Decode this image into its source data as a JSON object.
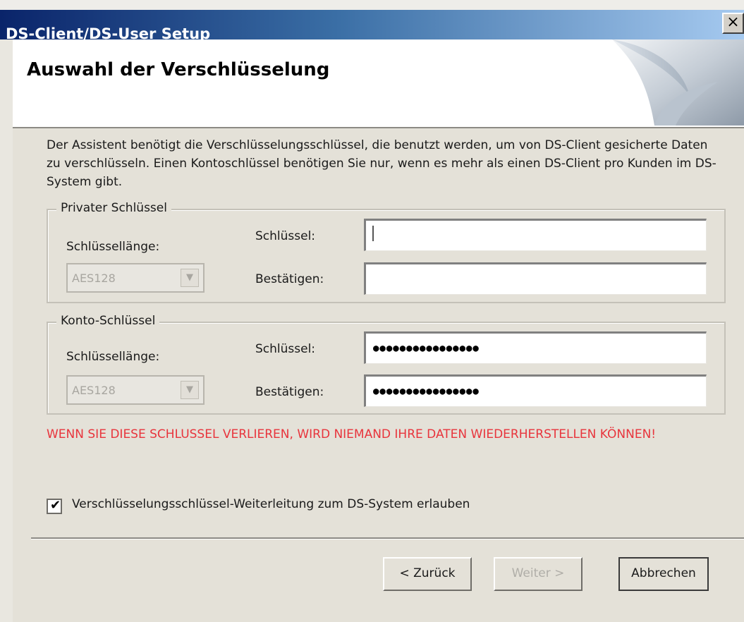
{
  "window": {
    "title": "DS-Client/DS-User Setup",
    "close_label": "×"
  },
  "header": {
    "title": "Auswahl der Verschlüsselung"
  },
  "description": "Der Assistent benötigt die Verschlüsselungsschlüssel, die benutzt werden, um von DS-Client gesicherte Daten zu verschlüsseln. Einen Kontoschlüssel benötigen Sie nur, wenn es mehr als einen DS-Client pro Kunden im DS-System gibt.",
  "private_key": {
    "group_title": "Privater Schlüssel",
    "key_length_label": "Schlüssellänge:",
    "key_length_value": "AES128",
    "key_label": "Schlüssel:",
    "key_value": "",
    "confirm_label": "Bestätigen:",
    "confirm_value": ""
  },
  "account_key": {
    "group_title": "Konto-Schlüssel",
    "key_length_label": "Schlüssellänge:",
    "key_length_value": "AES128",
    "key_label": "Schlüssel:",
    "key_value": "●●●●●●●●●●●●●●●●",
    "confirm_label": "Bestätigen:",
    "confirm_value": "●●●●●●●●●●●●●●●●"
  },
  "warning": "WENN SIE DIESE SCHLUSSEL VERLIEREN, WIRD NIEMAND IHRE DATEN WIEDERHERSTELLEN KÖNNEN!",
  "forwarding": {
    "checked": true,
    "label": "Verschlüsselungsschlüssel-Weiterleitung zum DS-System erlauben"
  },
  "buttons": {
    "back": "< Zurück",
    "next": "Weiter >",
    "cancel": "Abbrechen"
  },
  "colors": {
    "warning": "#e8343c",
    "titlebar_start": "#0a246a",
    "titlebar_end": "#a6caf0"
  }
}
